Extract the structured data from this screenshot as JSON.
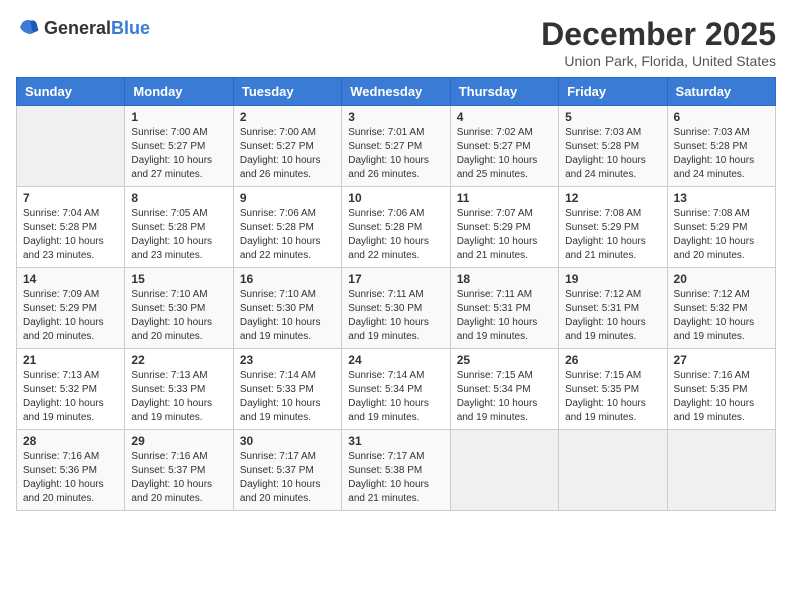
{
  "logo": {
    "general": "General",
    "blue": "Blue"
  },
  "title": "December 2025",
  "location": "Union Park, Florida, United States",
  "days_of_week": [
    "Sunday",
    "Monday",
    "Tuesday",
    "Wednesday",
    "Thursday",
    "Friday",
    "Saturday"
  ],
  "weeks": [
    [
      {
        "day": "",
        "sunrise": "",
        "sunset": "",
        "daylight": ""
      },
      {
        "day": "1",
        "sunrise": "Sunrise: 7:00 AM",
        "sunset": "Sunset: 5:27 PM",
        "daylight": "Daylight: 10 hours and 27 minutes."
      },
      {
        "day": "2",
        "sunrise": "Sunrise: 7:00 AM",
        "sunset": "Sunset: 5:27 PM",
        "daylight": "Daylight: 10 hours and 26 minutes."
      },
      {
        "day": "3",
        "sunrise": "Sunrise: 7:01 AM",
        "sunset": "Sunset: 5:27 PM",
        "daylight": "Daylight: 10 hours and 26 minutes."
      },
      {
        "day": "4",
        "sunrise": "Sunrise: 7:02 AM",
        "sunset": "Sunset: 5:27 PM",
        "daylight": "Daylight: 10 hours and 25 minutes."
      },
      {
        "day": "5",
        "sunrise": "Sunrise: 7:03 AM",
        "sunset": "Sunset: 5:28 PM",
        "daylight": "Daylight: 10 hours and 24 minutes."
      },
      {
        "day": "6",
        "sunrise": "Sunrise: 7:03 AM",
        "sunset": "Sunset: 5:28 PM",
        "daylight": "Daylight: 10 hours and 24 minutes."
      }
    ],
    [
      {
        "day": "7",
        "sunrise": "Sunrise: 7:04 AM",
        "sunset": "Sunset: 5:28 PM",
        "daylight": "Daylight: 10 hours and 23 minutes."
      },
      {
        "day": "8",
        "sunrise": "Sunrise: 7:05 AM",
        "sunset": "Sunset: 5:28 PM",
        "daylight": "Daylight: 10 hours and 23 minutes."
      },
      {
        "day": "9",
        "sunrise": "Sunrise: 7:06 AM",
        "sunset": "Sunset: 5:28 PM",
        "daylight": "Daylight: 10 hours and 22 minutes."
      },
      {
        "day": "10",
        "sunrise": "Sunrise: 7:06 AM",
        "sunset": "Sunset: 5:28 PM",
        "daylight": "Daylight: 10 hours and 22 minutes."
      },
      {
        "day": "11",
        "sunrise": "Sunrise: 7:07 AM",
        "sunset": "Sunset: 5:29 PM",
        "daylight": "Daylight: 10 hours and 21 minutes."
      },
      {
        "day": "12",
        "sunrise": "Sunrise: 7:08 AM",
        "sunset": "Sunset: 5:29 PM",
        "daylight": "Daylight: 10 hours and 21 minutes."
      },
      {
        "day": "13",
        "sunrise": "Sunrise: 7:08 AM",
        "sunset": "Sunset: 5:29 PM",
        "daylight": "Daylight: 10 hours and 20 minutes."
      }
    ],
    [
      {
        "day": "14",
        "sunrise": "Sunrise: 7:09 AM",
        "sunset": "Sunset: 5:29 PM",
        "daylight": "Daylight: 10 hours and 20 minutes."
      },
      {
        "day": "15",
        "sunrise": "Sunrise: 7:10 AM",
        "sunset": "Sunset: 5:30 PM",
        "daylight": "Daylight: 10 hours and 20 minutes."
      },
      {
        "day": "16",
        "sunrise": "Sunrise: 7:10 AM",
        "sunset": "Sunset: 5:30 PM",
        "daylight": "Daylight: 10 hours and 19 minutes."
      },
      {
        "day": "17",
        "sunrise": "Sunrise: 7:11 AM",
        "sunset": "Sunset: 5:30 PM",
        "daylight": "Daylight: 10 hours and 19 minutes."
      },
      {
        "day": "18",
        "sunrise": "Sunrise: 7:11 AM",
        "sunset": "Sunset: 5:31 PM",
        "daylight": "Daylight: 10 hours and 19 minutes."
      },
      {
        "day": "19",
        "sunrise": "Sunrise: 7:12 AM",
        "sunset": "Sunset: 5:31 PM",
        "daylight": "Daylight: 10 hours and 19 minutes."
      },
      {
        "day": "20",
        "sunrise": "Sunrise: 7:12 AM",
        "sunset": "Sunset: 5:32 PM",
        "daylight": "Daylight: 10 hours and 19 minutes."
      }
    ],
    [
      {
        "day": "21",
        "sunrise": "Sunrise: 7:13 AM",
        "sunset": "Sunset: 5:32 PM",
        "daylight": "Daylight: 10 hours and 19 minutes."
      },
      {
        "day": "22",
        "sunrise": "Sunrise: 7:13 AM",
        "sunset": "Sunset: 5:33 PM",
        "daylight": "Daylight: 10 hours and 19 minutes."
      },
      {
        "day": "23",
        "sunrise": "Sunrise: 7:14 AM",
        "sunset": "Sunset: 5:33 PM",
        "daylight": "Daylight: 10 hours and 19 minutes."
      },
      {
        "day": "24",
        "sunrise": "Sunrise: 7:14 AM",
        "sunset": "Sunset: 5:34 PM",
        "daylight": "Daylight: 10 hours and 19 minutes."
      },
      {
        "day": "25",
        "sunrise": "Sunrise: 7:15 AM",
        "sunset": "Sunset: 5:34 PM",
        "daylight": "Daylight: 10 hours and 19 minutes."
      },
      {
        "day": "26",
        "sunrise": "Sunrise: 7:15 AM",
        "sunset": "Sunset: 5:35 PM",
        "daylight": "Daylight: 10 hours and 19 minutes."
      },
      {
        "day": "27",
        "sunrise": "Sunrise: 7:16 AM",
        "sunset": "Sunset: 5:35 PM",
        "daylight": "Daylight: 10 hours and 19 minutes."
      }
    ],
    [
      {
        "day": "28",
        "sunrise": "Sunrise: 7:16 AM",
        "sunset": "Sunset: 5:36 PM",
        "daylight": "Daylight: 10 hours and 20 minutes."
      },
      {
        "day": "29",
        "sunrise": "Sunrise: 7:16 AM",
        "sunset": "Sunset: 5:37 PM",
        "daylight": "Daylight: 10 hours and 20 minutes."
      },
      {
        "day": "30",
        "sunrise": "Sunrise: 7:17 AM",
        "sunset": "Sunset: 5:37 PM",
        "daylight": "Daylight: 10 hours and 20 minutes."
      },
      {
        "day": "31",
        "sunrise": "Sunrise: 7:17 AM",
        "sunset": "Sunset: 5:38 PM",
        "daylight": "Daylight: 10 hours and 21 minutes."
      },
      {
        "day": "",
        "sunrise": "",
        "sunset": "",
        "daylight": ""
      },
      {
        "day": "",
        "sunrise": "",
        "sunset": "",
        "daylight": ""
      },
      {
        "day": "",
        "sunrise": "",
        "sunset": "",
        "daylight": ""
      }
    ]
  ]
}
